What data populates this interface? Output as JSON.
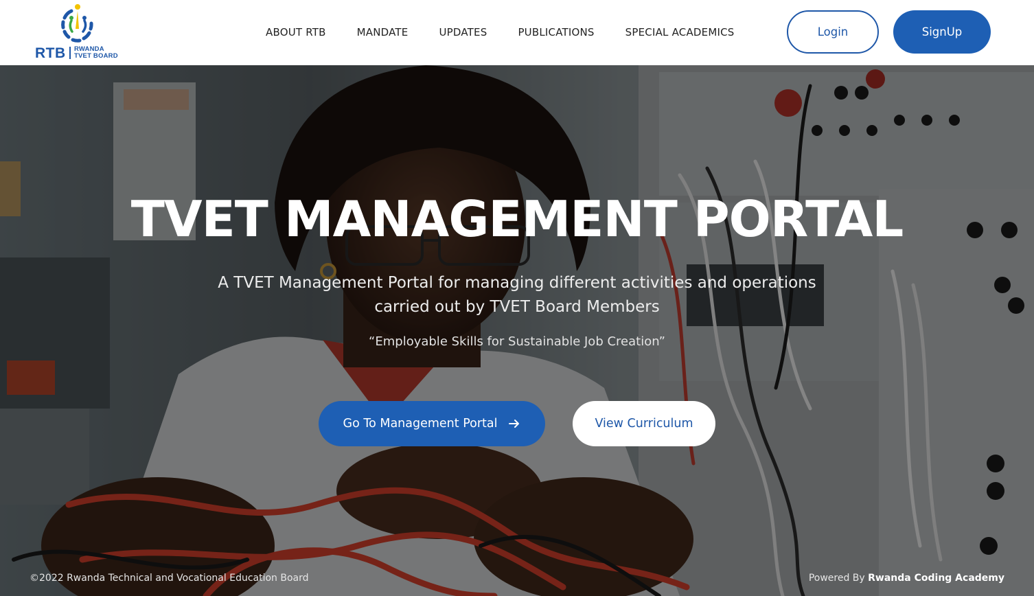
{
  "header": {
    "logo": {
      "abbr": "RTB",
      "name_line1": "RWANDA",
      "name_line2": "TVET BOARD"
    },
    "nav": [
      {
        "label": "ABOUT RTB"
      },
      {
        "label": "MANDATE"
      },
      {
        "label": "UPDATES"
      },
      {
        "label": "PUBLICATIONS"
      },
      {
        "label": "SPECIAL ACADEMICS"
      }
    ],
    "login_label": "Login",
    "signup_label": "SignUp"
  },
  "hero": {
    "title": "TVET MANAGEMENT PORTAL",
    "subtitle_line1": "A TVET Management Portal for managing different activities and operations",
    "subtitle_line2": "carried out by TVET Board Members",
    "motto": "“Employable Skills for Sustainable Job Creation”",
    "portal_button_label": "Go To Management Portal",
    "portal_button_icon": "arrow-right-icon",
    "curriculum_button_label": "View Curriculum"
  },
  "footer": {
    "copyright": "©2022 Rwanda Technical and Vocational Education Board",
    "powered_prefix": "Powered By",
    "powered_name": "Rwanda Coding Academy"
  },
  "colors": {
    "brand_blue": "#1e5fb4",
    "logo_blue": "#1e57a8",
    "logo_yellow": "#f2c200",
    "logo_green": "#3aa845"
  }
}
